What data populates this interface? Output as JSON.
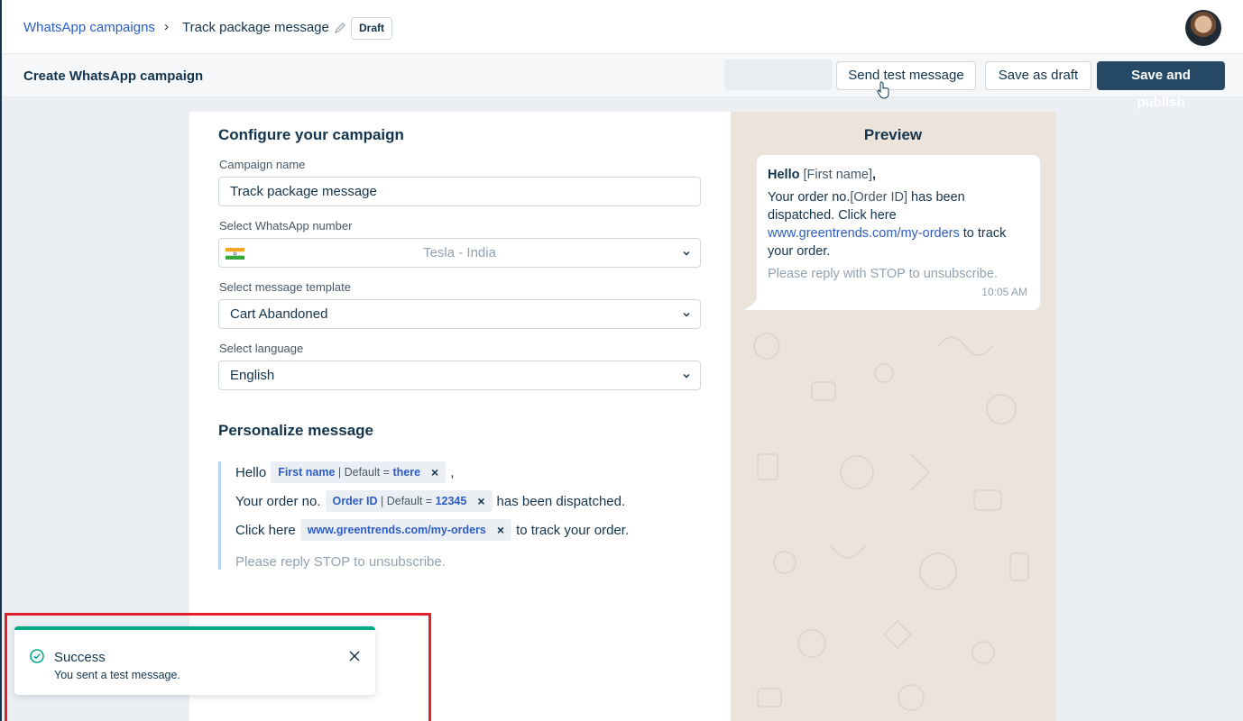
{
  "header": {
    "breadcrumb_link": "WhatsApp campaigns",
    "breadcrumb_separator": "›",
    "breadcrumb_current": "Track package message",
    "status_badge": "Draft"
  },
  "subheader": {
    "title": "Create WhatsApp campaign",
    "send_test_label": "Send test message",
    "save_draft_label": "Save as draft",
    "save_publish_label": "Save and publish"
  },
  "form": {
    "configure_title": "Configure your campaign",
    "campaign_name_label": "Campaign name",
    "campaign_name_value": "Track package message",
    "whatsapp_number_label": "Select WhatsApp number",
    "whatsapp_number_value": "Tesla - India",
    "template_label": "Select message template",
    "template_value": "Cart Abandoned",
    "language_label": "Select language",
    "language_value": "English",
    "personalize_title": "Personalize message",
    "message": {
      "line1_prefix": "Hello",
      "line1_tag_field": "First name",
      "line1_tag_default_label": " | Default = ",
      "line1_tag_default_value": "there",
      "line1_suffix": ",",
      "line2_prefix": "Your order no.",
      "line2_tag_field": "Order ID",
      "line2_tag_default_label": " | Default = ",
      "line2_tag_default_value": "12345",
      "line2_suffix": "has been dispatched.",
      "line3_prefix": "Click here",
      "line3_tag_link": "www.greentrends.com/my-orders",
      "line3_suffix": "to track your order.",
      "tag_remove": "×",
      "unsubscribe": "Please reply STOP to unsubscribe."
    }
  },
  "preview": {
    "title": "Preview",
    "greeting": "Hello",
    "greeting_var": "[First name]",
    "greeting_suffix": ",",
    "body_prefix": "Your order no.",
    "body_var": "[Order ID]",
    "body_mid": " has been dispatched. Click here",
    "link": "www.greentrends.com/my-orders",
    "body_suffix": " to track your order.",
    "unsubscribe": "Please reply with STOP to unsubscribe.",
    "time": "10:05 AM"
  },
  "toast": {
    "title": "Success",
    "message": "You sent a test message."
  },
  "colors": {
    "accent_link": "#2c5cc5",
    "primary_button": "#264966",
    "success": "#00a886",
    "highlight": "#e0202c"
  },
  "icons": [
    "edit-icon",
    "avatar",
    "cursor-icon",
    "chevron-down-icon",
    "india-flag-icon",
    "check-circle-icon",
    "close-icon"
  ]
}
